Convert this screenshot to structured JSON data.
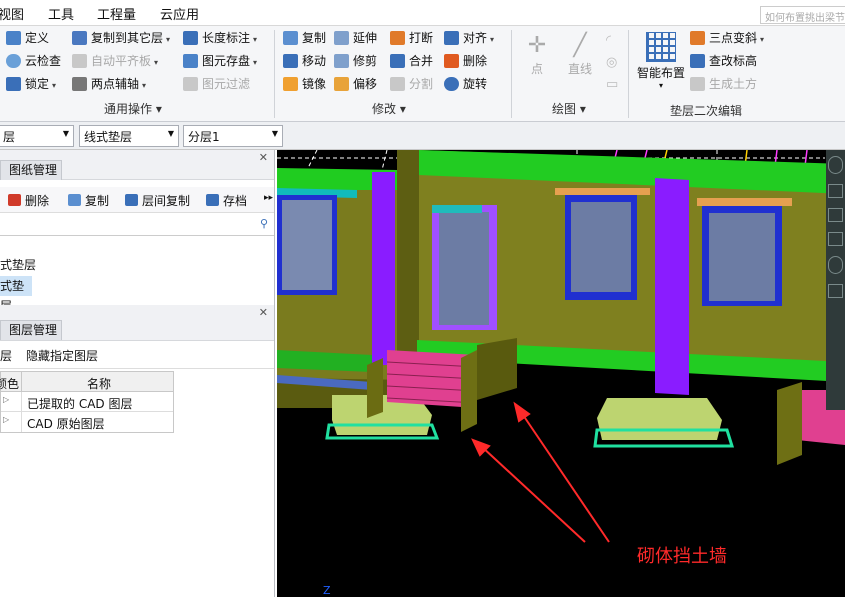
{
  "menu": [
    "视图",
    "工具",
    "工程量",
    "云应用"
  ],
  "search": {
    "placeholder": "如何布置挑出梁节"
  },
  "ribbon": {
    "general": {
      "label": "通用操作",
      "items": [
        "定义",
        "云检查",
        "锁定",
        "复制到其它层",
        "自动平齐板",
        "两点辅轴",
        "长度标注",
        "图元存盘",
        "图元过滤"
      ]
    },
    "modify": {
      "label": "修改",
      "items": [
        "复制",
        "移动",
        "镜像",
        "延伸",
        "修剪",
        "偏移",
        "打断",
        "合并",
        "分割",
        "对齐",
        "删除",
        "旋转"
      ]
    },
    "draw": {
      "label": "绘图",
      "items": [
        "点",
        "直线"
      ]
    },
    "layer_edit": {
      "label": "垫层二次编辑",
      "big": "智能布置",
      "items": [
        "三点变斜",
        "查改标高",
        "生成土方"
      ]
    }
  },
  "toolbar": {
    "combo1": "层",
    "combo2": "线式垫层",
    "combo3": "分层1"
  },
  "drawing_panel": {
    "tab": "图纸管理",
    "buttons": [
      "删除",
      "复制",
      "层间复制",
      "存档"
    ],
    "items": [
      "式垫层",
      "式垫层"
    ]
  },
  "layer_panel": {
    "tab": "图层管理",
    "links": [
      "层",
      "隐藏指定图层"
    ],
    "columns": [
      "颜色",
      "名称"
    ],
    "rows": [
      {
        "name": "已提取的 CAD 图层"
      },
      {
        "name": "CAD 原始图层"
      }
    ]
  },
  "annotation": {
    "text": "砌体挡土墙",
    "color": "#ff2a2a"
  },
  "axis_label": "Z"
}
